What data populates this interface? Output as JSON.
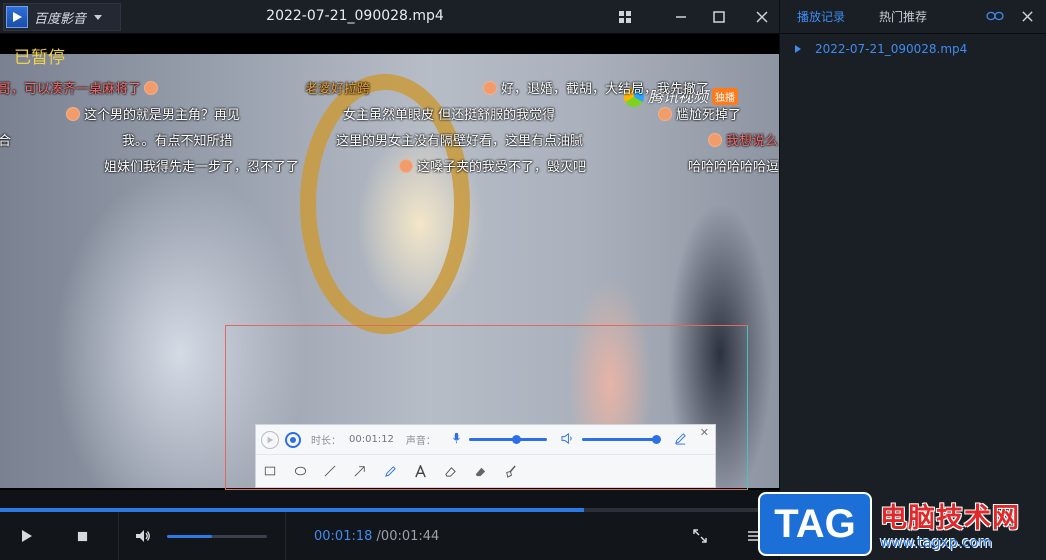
{
  "app": {
    "name": "百度影音"
  },
  "window": {
    "title": "2022-07-21_090028.mp4"
  },
  "panel": {
    "tabs": [
      {
        "label": "播放记录",
        "active": true
      },
      {
        "label": "热门推荐",
        "active": false
      }
    ],
    "playlist": [
      {
        "label": "2022-07-21_090028.mp4"
      }
    ]
  },
  "video": {
    "status": "已暂停",
    "watermark": {
      "text": "腾讯视频",
      "badge": "独播"
    },
    "danmaku": [
      {
        "text": "哥，可以凑齐一桌麻将了",
        "color": "#f26b6b"
      },
      {
        "text": "老婆好拉跨",
        "color": "#e8a03a"
      },
      {
        "text": "好，退婚，截胡，大结局，我先撤了",
        "color": "#ffffff"
      },
      {
        "text": "这个男的就是男主角？再见",
        "color": "#ffffff"
      },
      {
        "text": "女主虽然单眼皮 但还挺舒服的我觉得",
        "color": "#ffffff"
      },
      {
        "text": "尴尬死掉了",
        "color": "#ffffff"
      },
      {
        "text": "合",
        "color": "#ffffff"
      },
      {
        "text": "我。。有点不知所措",
        "color": "#ffffff"
      },
      {
        "text": "这里的男女主没有隔壁好看，这里有点油腻",
        "color": "#ffffff"
      },
      {
        "text": "我想说么",
        "color": "#f26b6b"
      },
      {
        "text": "姐妹们我得先走一步了，忍不了了",
        "color": "#ffffff"
      },
      {
        "text": "这嗓子夹的我受不了，毁灭吧",
        "color": "#ffffff"
      },
      {
        "text": "哈哈哈哈哈哈逗",
        "color": "#ffffff"
      }
    ]
  },
  "recorder": {
    "duration_label": "时长：",
    "duration_value": "00:01:12",
    "audio_label": "声音：",
    "mic_level": 0.6,
    "speaker_level": 1.0
  },
  "player": {
    "progress": 0.75,
    "volume": 0.45,
    "time_current": "00:01:18",
    "time_separator": "/",
    "time_total": "00:01:44"
  },
  "overlay": {
    "tag": "TAG",
    "site_name": "电脑技术网",
    "url": "www.tagxp.com"
  },
  "colors": {
    "accent": "#3f8cf0",
    "paused": "#f1d24a"
  }
}
